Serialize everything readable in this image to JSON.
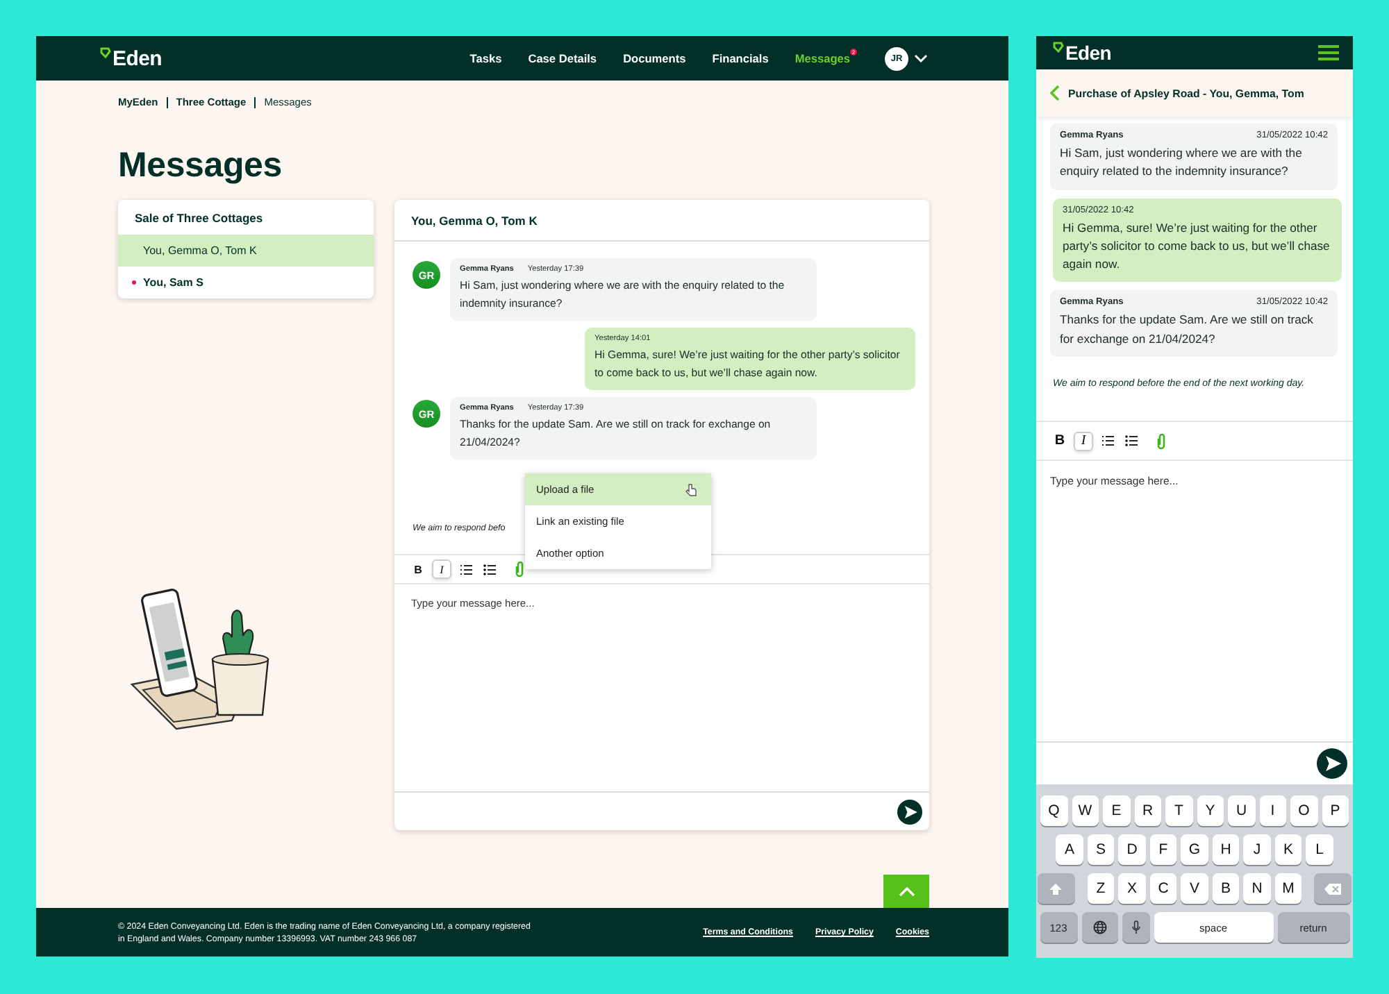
{
  "desktop": {
    "header": {
      "brand": "Eden",
      "nav": [
        {
          "label": "Tasks",
          "selected": false
        },
        {
          "label": "Case Details",
          "selected": false
        },
        {
          "label": "Documents",
          "selected": false
        },
        {
          "label": "Financials",
          "selected": false
        },
        {
          "label": "Messages",
          "selected": true,
          "badge": "2"
        }
      ],
      "avatar": "JR"
    },
    "breadcrumb": [
      {
        "label": "MyEden",
        "current": false
      },
      {
        "label": "Three Cottage",
        "current": false
      },
      {
        "label": "Messages",
        "current": true
      }
    ],
    "title": "Messages",
    "threads": {
      "heading": "Sale of Three Cottages",
      "items": [
        {
          "label": "You, Gemma O, Tom K",
          "selected": true,
          "unread": false
        },
        {
          "label": "You, Sam S",
          "selected": false,
          "unread": true
        }
      ]
    },
    "chat": {
      "title": "You, Gemma O, Tom K",
      "messages": [
        {
          "kind": "received",
          "initials": "GR",
          "sender": "Gemma Ryans",
          "time": "Yesterday  17:39",
          "text": "Hi Sam, just wondering where we are with the enquiry related to the indemnity insurance?"
        },
        {
          "kind": "sent",
          "time": "Yesterday  14:01",
          "text": "Hi Gemma, sure! We’re just waiting for the other party’s solicitor to come back to us, but we’ll chase again now."
        },
        {
          "kind": "received",
          "initials": "GR",
          "sender": "Gemma Ryans",
          "time": "Yesterday  17:39",
          "text": "Thanks for the update Sam. Are we still on track for exchange on 21/04/2024?"
        }
      ],
      "notice": "We aim to respond befo",
      "toolbar": [
        {
          "kind": "bold",
          "label": "B",
          "active": false
        },
        {
          "kind": "italic",
          "label": "I",
          "active": true
        },
        {
          "kind": "ordered-list",
          "active": false
        },
        {
          "kind": "bullet-list",
          "active": false
        },
        {
          "kind": "attach",
          "active": false
        }
      ],
      "menu": [
        {
          "label": "Upload a file",
          "selected": true
        },
        {
          "label": "Link an existing file",
          "selected": false
        },
        {
          "label": "Another option",
          "selected": false
        }
      ],
      "placeholder": "Type your message here..."
    },
    "footer": {
      "legal": "© 2024 Eden Conveyancing Ltd. Eden is the trading name of Eden Conveyancing Ltd, a company registered in England and Wales. Company number 13396993. VAT number 243 966 087",
      "links": [
        "Terms and Conditions",
        "Privacy Policy",
        "Cookies"
      ]
    }
  },
  "mobile": {
    "brand": "Eden",
    "title": "Purchase of Apsley Road - You, Gemma, Tom",
    "messages": [
      {
        "kind": "received",
        "sender": "Gemma Ryans",
        "time": "31/05/2022  10:42",
        "text": "Hi Sam, just wondering where we are with the enquiry related to the indemnity insurance?"
      },
      {
        "kind": "sent",
        "time": "31/05/2022  10:42",
        "text": "Hi Gemma, sure! We’re just waiting for the other party’s solicitor to come back to us, but we’ll chase again now."
      },
      {
        "kind": "received",
        "sender": "Gemma Ryans",
        "time": "31/05/2022  10:42",
        "text": "Thanks for the update Sam. Are we still on track for exchange on 21/04/2024?"
      }
    ],
    "notice": "We aim to respond before the end of the next working day.",
    "toolbar": [
      {
        "kind": "bold",
        "label": "B",
        "active": false
      },
      {
        "kind": "italic",
        "label": "I",
        "active": true
      },
      {
        "kind": "ordered-list",
        "active": false
      },
      {
        "kind": "bullet-list",
        "active": false
      },
      {
        "kind": "attach",
        "active": false
      }
    ],
    "placeholder": "Type your message here...",
    "keyboard": [
      [
        {
          "kind": "char",
          "label": "Q"
        },
        {
          "kind": "char",
          "label": "W"
        },
        {
          "kind": "char",
          "label": "E"
        },
        {
          "kind": "char",
          "label": "R"
        },
        {
          "kind": "char",
          "label": "T"
        },
        {
          "kind": "char",
          "label": "Y"
        },
        {
          "kind": "char",
          "label": "U"
        },
        {
          "kind": "char",
          "label": "I"
        },
        {
          "kind": "char",
          "label": "O"
        },
        {
          "kind": "char",
          "label": "P"
        }
      ],
      [
        {
          "kind": "char",
          "label": "A"
        },
        {
          "kind": "char",
          "label": "S"
        },
        {
          "kind": "char",
          "label": "D"
        },
        {
          "kind": "char",
          "label": "F"
        },
        {
          "kind": "char",
          "label": "G"
        },
        {
          "kind": "char",
          "label": "H"
        },
        {
          "kind": "char",
          "label": "J"
        },
        {
          "kind": "char",
          "label": "K"
        },
        {
          "kind": "char",
          "label": "L"
        }
      ],
      [
        {
          "kind": "shift"
        },
        {
          "kind": "char",
          "label": "Z"
        },
        {
          "kind": "char",
          "label": "X"
        },
        {
          "kind": "char",
          "label": "C"
        },
        {
          "kind": "char",
          "label": "V"
        },
        {
          "kind": "char",
          "label": "B"
        },
        {
          "kind": "char",
          "label": "N"
        },
        {
          "kind": "char",
          "label": "M"
        },
        {
          "kind": "backspace"
        }
      ],
      [
        {
          "kind": "mode",
          "label": "123"
        },
        {
          "kind": "globe"
        },
        {
          "kind": "mic"
        },
        {
          "kind": "space",
          "label": "space"
        },
        {
          "kind": "return",
          "label": "return"
        }
      ]
    ]
  }
}
